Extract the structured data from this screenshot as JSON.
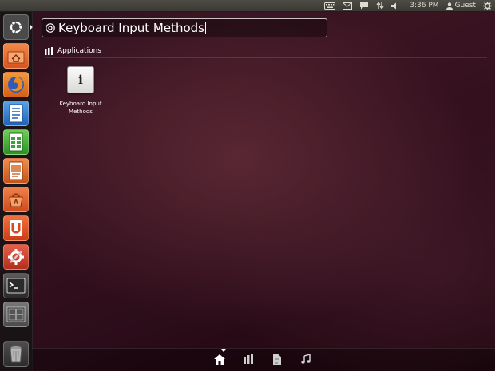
{
  "top_panel": {
    "icons": [
      "keyboard-icon",
      "mail-icon",
      "messaging-icon",
      "network-icon",
      "volume-icon"
    ],
    "clock": "3:36 PM",
    "user": "Guest",
    "session_icon": "gear-icon"
  },
  "launcher": {
    "items": [
      {
        "name": "dash-home-button",
        "icon": "ubuntu-logo-icon",
        "color": "#4a4a4a"
      },
      {
        "name": "launcher-home-folder",
        "icon": "home-folder-icon",
        "color": "#e8642a"
      },
      {
        "name": "launcher-firefox",
        "icon": "firefox-icon",
        "color": "#e77a1c"
      },
      {
        "name": "launcher-writer",
        "icon": "writer-icon",
        "color": "#2f7fd4"
      },
      {
        "name": "launcher-calc",
        "icon": "calc-icon",
        "color": "#3aa63a"
      },
      {
        "name": "launcher-impress",
        "icon": "impress-icon",
        "color": "#d16a24"
      },
      {
        "name": "launcher-software-center",
        "icon": "software-center-icon",
        "color": "#e2562a"
      },
      {
        "name": "launcher-ubuntu-one",
        "icon": "ubuntu-one-icon",
        "color": "#e0521e"
      },
      {
        "name": "launcher-system-settings",
        "icon": "system-settings-icon",
        "color": "#d8412a"
      },
      {
        "name": "launcher-terminal",
        "icon": "terminal-icon",
        "color": "#333333"
      },
      {
        "name": "launcher-workspace-switcher",
        "icon": "workspace-switcher-icon",
        "color": "#555555"
      },
      {
        "name": "launcher-trash",
        "icon": "trash-icon",
        "color": "#3b3b3b"
      }
    ]
  },
  "dash": {
    "search": {
      "value": "Keyboard Input Methods"
    },
    "category": {
      "label": "Applications"
    },
    "results": [
      {
        "label_line1": "Keyboard Input",
        "label_line2": "Methods",
        "icon_letter": "i"
      }
    ],
    "lens_bar": [
      "home-lens-icon",
      "applications-lens-icon",
      "files-lens-icon",
      "music-lens-icon"
    ]
  }
}
